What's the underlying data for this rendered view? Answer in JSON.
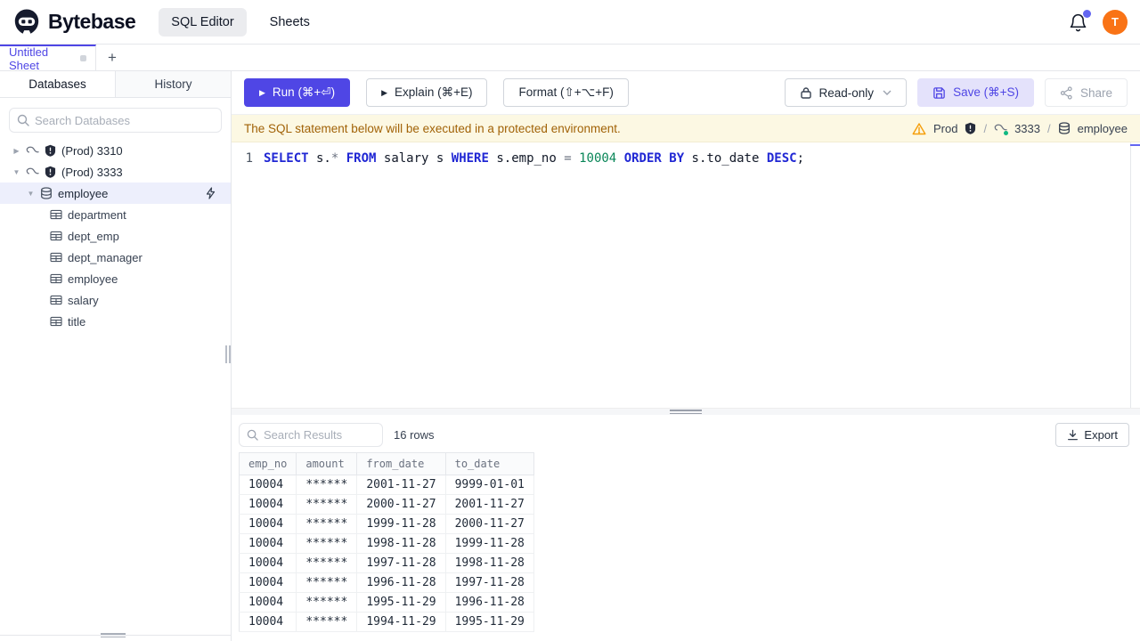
{
  "topbar": {
    "brand": "Bytebase",
    "nav": [
      {
        "label": "SQL Editor",
        "active": true
      },
      {
        "label": "Sheets",
        "active": false
      }
    ],
    "avatar_initial": "T"
  },
  "sheet_tabs": {
    "active": "Untitled Sheet",
    "add": "+"
  },
  "sidebar": {
    "tabs": [
      {
        "label": "Databases",
        "active": true
      },
      {
        "label": "History",
        "active": false
      }
    ],
    "search_placeholder": "Search Databases",
    "tree": {
      "instances": [
        {
          "label": "(Prod) 3310",
          "expanded": false
        },
        {
          "label": "(Prod) 3333",
          "expanded": true
        }
      ],
      "database": "employee",
      "tables": [
        "department",
        "dept_emp",
        "dept_manager",
        "employee",
        "salary",
        "title"
      ]
    }
  },
  "toolbar": {
    "run": "Run (⌘+⏎)",
    "explain": "Explain (⌘+E)",
    "format": "Format (⇧+⌥+F)",
    "readonly": "Read-only",
    "save": "Save (⌘+S)",
    "share": "Share"
  },
  "banner": {
    "message": "The SQL statement below will be executed in a protected environment.",
    "breadcrumb": {
      "environment": "Prod",
      "instance": "3333",
      "database": "employee",
      "separator": "/"
    }
  },
  "editor": {
    "line_number": "1",
    "sql_text": "SELECT s.* FROM salary s WHERE s.emp_no = 10004 ORDER BY s.to_date DESC;",
    "tokens": [
      {
        "text": "SELECT",
        "type": "keyword"
      },
      {
        "text": " s.",
        "type": "plain"
      },
      {
        "text": "*",
        "type": "operator"
      },
      {
        "text": " ",
        "type": "plain"
      },
      {
        "text": "FROM",
        "type": "keyword"
      },
      {
        "text": " salary s ",
        "type": "plain"
      },
      {
        "text": "WHERE",
        "type": "keyword"
      },
      {
        "text": " s.emp_no ",
        "type": "plain"
      },
      {
        "text": "=",
        "type": "operator"
      },
      {
        "text": " ",
        "type": "plain"
      },
      {
        "text": "10004",
        "type": "number"
      },
      {
        "text": " ",
        "type": "plain"
      },
      {
        "text": "ORDER BY",
        "type": "keyword"
      },
      {
        "text": " s.to_date ",
        "type": "plain"
      },
      {
        "text": "DESC",
        "type": "keyword"
      },
      {
        "text": ";",
        "type": "plain"
      }
    ]
  },
  "results": {
    "search_placeholder": "Search Results",
    "row_count": "16 rows",
    "export_label": "Export",
    "columns": [
      "emp_no",
      "amount",
      "from_date",
      "to_date"
    ],
    "rows": [
      [
        "10004",
        "******",
        "2001-11-27",
        "9999-01-01"
      ],
      [
        "10004",
        "******",
        "2000-11-27",
        "2001-11-27"
      ],
      [
        "10004",
        "******",
        "1999-11-28",
        "2000-11-27"
      ],
      [
        "10004",
        "******",
        "1998-11-28",
        "1999-11-28"
      ],
      [
        "10004",
        "******",
        "1997-11-28",
        "1998-11-28"
      ],
      [
        "10004",
        "******",
        "1996-11-28",
        "1997-11-28"
      ],
      [
        "10004",
        "******",
        "1995-11-29",
        "1996-11-28"
      ],
      [
        "10004",
        "******",
        "1994-11-29",
        "1995-11-29"
      ]
    ]
  },
  "colors": {
    "accent": "#4f46e5",
    "accent_light": "#e4e2fb",
    "selected_tree_bg": "#edeffc",
    "warning_bg": "#fcf8e3",
    "warning_text": "#a16207",
    "avatar_bg": "#f97316",
    "notification_dot": "#6366f1",
    "online_dot": "#10b981",
    "sql_keyword": "#2027d4",
    "sql_number": "#098658",
    "sql_operator": "#6b7280"
  }
}
